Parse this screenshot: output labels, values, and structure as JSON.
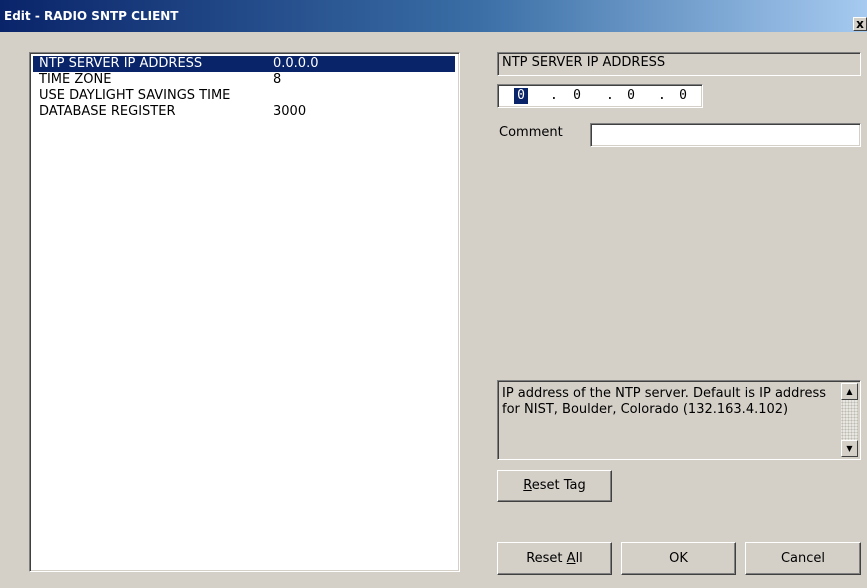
{
  "window": {
    "title": "Edit - RADIO SNTP CLIENT",
    "close_label": "x"
  },
  "tag_list": {
    "rows": [
      {
        "label": "NTP SERVER IP ADDRESS",
        "value": "0.0.0.0",
        "selected": true
      },
      {
        "label": "TIME ZONE",
        "value": "8",
        "selected": false
      },
      {
        "label": "USE DAYLIGHT SAVINGS TIME",
        "value": "",
        "selected": false
      },
      {
        "label": "DATABASE REGISTER",
        "value": "3000",
        "selected": false
      }
    ]
  },
  "editor": {
    "field_title": "NTP SERVER IP ADDRESS",
    "ip_octets": [
      "0",
      "0",
      "0",
      "0"
    ],
    "ip_separator": ".",
    "comment_label": "Comment",
    "comment_value": ""
  },
  "help": {
    "text": "IP address of the NTP server. Default is IP address for NIST, Boulder, Colorado (132.163.4.102)",
    "scroll_up_glyph": "▲",
    "scroll_down_glyph": "▼"
  },
  "buttons": {
    "reset_tag": {
      "underlined": "R",
      "rest": "eset Tag"
    },
    "reset_all": {
      "before": "Reset ",
      "underlined": "A",
      "rest": "ll"
    },
    "ok": "OK",
    "cancel": "Cancel"
  },
  "colors": {
    "title_bar_start": "#0a246a",
    "title_bar_end": "#a6caf0",
    "selection": "#0a246a",
    "face": "#d4d0c8"
  }
}
